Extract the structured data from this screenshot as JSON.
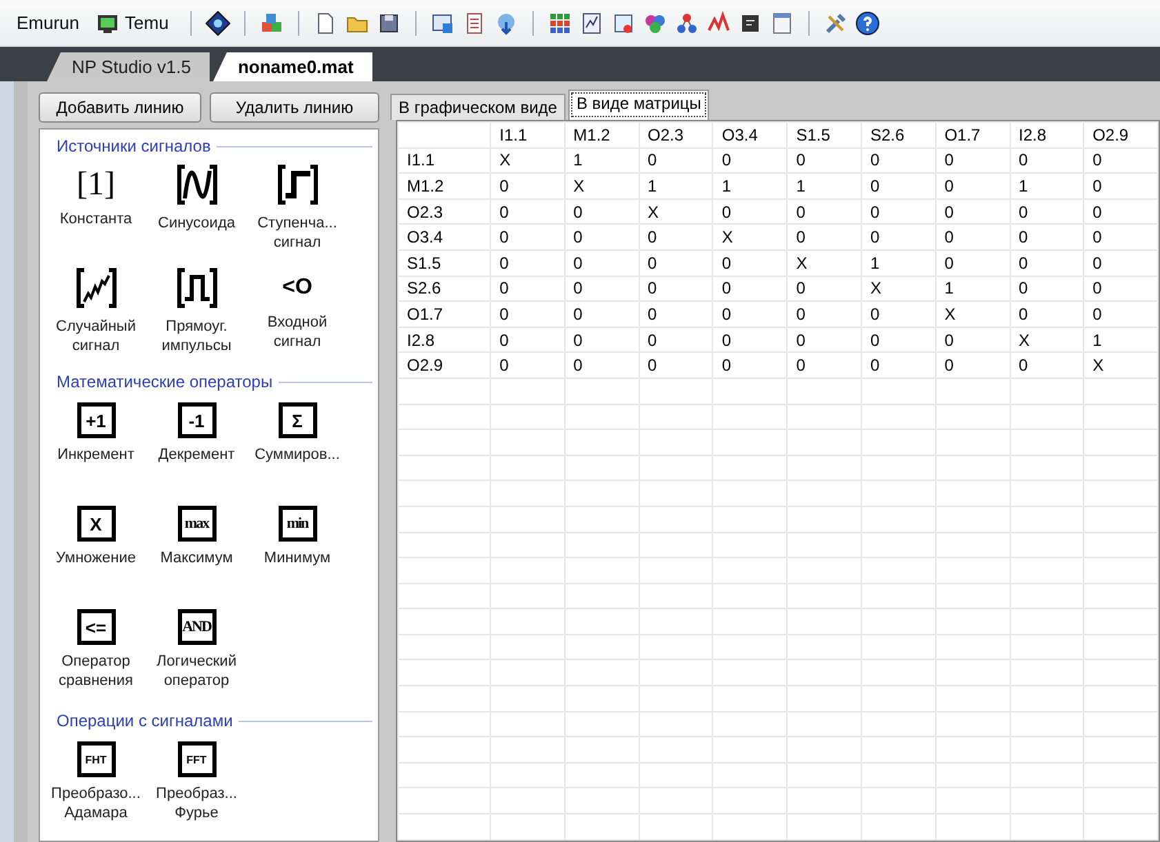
{
  "toolbar": {
    "items": [
      {
        "kind": "text",
        "label": "Emurun"
      },
      {
        "kind": "icon-text",
        "label": "Temu"
      }
    ]
  },
  "document_tabs": [
    {
      "label": "NP Studio v1.5",
      "selected": false
    },
    {
      "label": "noname0.mat",
      "selected": true
    }
  ],
  "left_panel": {
    "buttons": [
      "Добавить линию",
      "Удалить линию"
    ],
    "sections": [
      {
        "title": "Источники сигналов",
        "items": [
          {
            "kind": "constant",
            "glyph": "[1]",
            "label": "Константа"
          },
          {
            "kind": "sine",
            "label": "Синусоида"
          },
          {
            "kind": "step",
            "label": "Ступенча...\nсигнал"
          },
          {
            "kind": "random",
            "label": "Случайный\nсигнал"
          },
          {
            "kind": "pulse",
            "label": "Прямоуг.\nимпульсы"
          },
          {
            "kind": "input",
            "glyph": "<O",
            "label": "Входной\nсигнал"
          }
        ]
      },
      {
        "title": "Математические операторы",
        "items": [
          {
            "kind": "boxed",
            "glyph": "+1",
            "label": "Инкремент"
          },
          {
            "kind": "boxed",
            "glyph": "-1",
            "label": "Декремент"
          },
          {
            "kind": "boxed",
            "glyph": "Σ",
            "label": "Суммиров..."
          },
          {
            "kind": "boxed",
            "glyph": "X",
            "label": "Умножение"
          },
          {
            "kind": "boxed-serif",
            "glyph": "max",
            "label": "Максимум"
          },
          {
            "kind": "boxed-serif",
            "glyph": "min",
            "label": "Минимум"
          },
          {
            "kind": "boxed",
            "glyph": "<=",
            "label": "Оператор\nсравнения"
          },
          {
            "kind": "boxed-serif",
            "glyph": "AND",
            "label": "Логический\nоператор"
          }
        ]
      },
      {
        "title": "Операции с сигналами",
        "items": [
          {
            "kind": "boxed-small",
            "glyph": "FHT",
            "label": "Преобразо...\nАдамара"
          },
          {
            "kind": "boxed-small",
            "glyph": "FFT",
            "label": "Преобраз...\nФурье"
          }
        ]
      }
    ]
  },
  "view_tabs": [
    {
      "label": "В графическом виде",
      "selected": false
    },
    {
      "label": "В виде матрицы",
      "selected": true
    }
  ],
  "matrix": {
    "columns": [
      "I1.1",
      "M1.2",
      "O2.3",
      "O3.4",
      "S1.5",
      "S2.6",
      "O1.7",
      "I2.8",
      "O2.9"
    ],
    "rows": [
      {
        "label": "I1.1",
        "cells": [
          "X",
          "1",
          "0",
          "0",
          "0",
          "0",
          "0",
          "0",
          "0"
        ]
      },
      {
        "label": "M1.2",
        "cells": [
          "0",
          "X",
          "1",
          "1",
          "1",
          "0",
          "0",
          "1",
          "0"
        ]
      },
      {
        "label": "O2.3",
        "cells": [
          "0",
          "0",
          "X",
          "0",
          "0",
          "0",
          "0",
          "0",
          "0"
        ]
      },
      {
        "label": "O3.4",
        "cells": [
          "0",
          "0",
          "0",
          "X",
          "0",
          "0",
          "0",
          "0",
          "0"
        ]
      },
      {
        "label": "S1.5",
        "cells": [
          "0",
          "0",
          "0",
          "0",
          "X",
          "1",
          "0",
          "0",
          "0"
        ]
      },
      {
        "label": "S2.6",
        "cells": [
          "0",
          "0",
          "0",
          "0",
          "0",
          "X",
          "1",
          "0",
          "0"
        ]
      },
      {
        "label": "O1.7",
        "cells": [
          "0",
          "0",
          "0",
          "0",
          "0",
          "0",
          "X",
          "0",
          "0"
        ]
      },
      {
        "label": "I2.8",
        "cells": [
          "0",
          "0",
          "0",
          "0",
          "0",
          "0",
          "0",
          "X",
          "1"
        ]
      },
      {
        "label": "O2.9",
        "cells": [
          "0",
          "0",
          "0",
          "0",
          "0",
          "0",
          "0",
          "0",
          "X"
        ]
      }
    ]
  }
}
